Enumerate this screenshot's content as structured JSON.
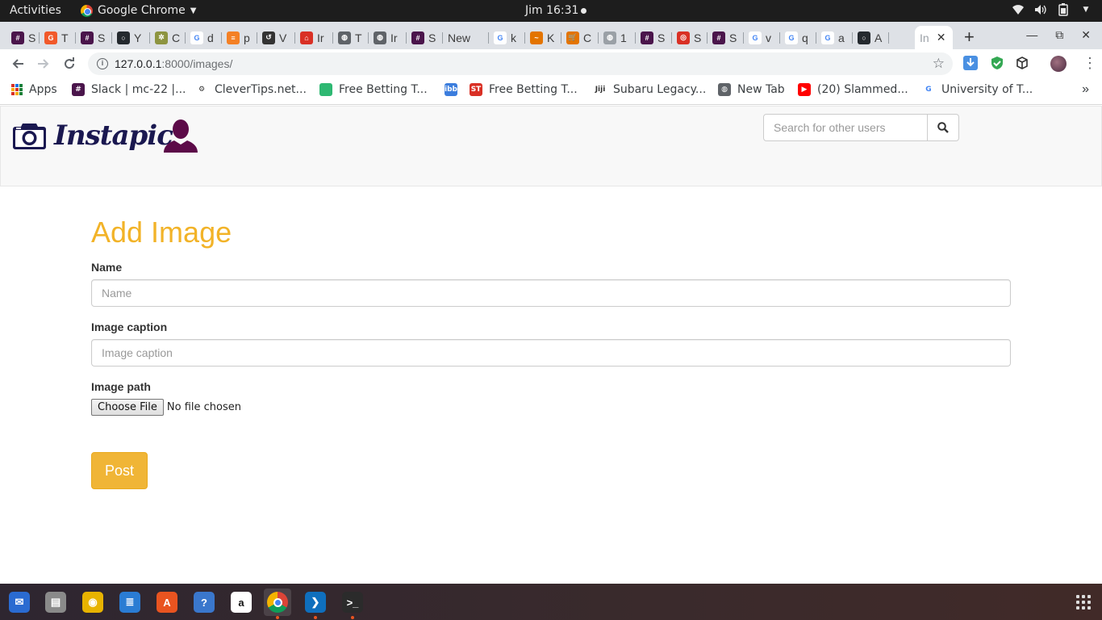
{
  "system": {
    "activities": "Activities",
    "app_name": "Google Chrome",
    "clock": "Jim 16:31"
  },
  "tabs": [
    {
      "label": "S",
      "color": "#4a154b",
      "glyph": "#"
    },
    {
      "label": "T",
      "color": "#f1592a",
      "glyph": "G"
    },
    {
      "label": "S",
      "color": "#4a154b",
      "glyph": "#"
    },
    {
      "label": "Y",
      "color": "#24292e",
      "glyph": "○"
    },
    {
      "label": "C",
      "color": "#8d9440",
      "glyph": "✲"
    },
    {
      "label": "d",
      "color": "#4285f4",
      "glyph": "G"
    },
    {
      "label": "p",
      "color": "#f48024",
      "glyph": "≡"
    },
    {
      "label": "V",
      "color": "#333333",
      "glyph": "↺"
    },
    {
      "label": "Ir",
      "color": "#d93025",
      "glyph": "⌂"
    },
    {
      "label": "T",
      "color": "#5f6368",
      "glyph": "◍"
    },
    {
      "label": "Ir",
      "color": "#5f6368",
      "glyph": "◍"
    },
    {
      "label": "S",
      "color": "#4a154b",
      "glyph": "#"
    },
    {
      "label": "New",
      "color": "#ffffff",
      "glyph": ""
    },
    {
      "label": "k",
      "color": "#4285f4",
      "glyph": "G"
    },
    {
      "label": "K",
      "color": "#e37400",
      "glyph": "~"
    },
    {
      "label": "C",
      "color": "#e37400",
      "glyph": "🛒"
    },
    {
      "label": "1",
      "color": "#9aa0a6",
      "glyph": "◍"
    },
    {
      "label": "S",
      "color": "#4a154b",
      "glyph": "#"
    },
    {
      "label": "S",
      "color": "#d93025",
      "glyph": "◎"
    },
    {
      "label": "S",
      "color": "#4a154b",
      "glyph": "#"
    },
    {
      "label": "v",
      "color": "#4285f4",
      "glyph": "G"
    },
    {
      "label": "q",
      "color": "#4285f4",
      "glyph": "G"
    },
    {
      "label": "a",
      "color": "#4285f4",
      "glyph": "G"
    },
    {
      "label": "A",
      "color": "#24292e",
      "glyph": "○"
    }
  ],
  "active_tab": {
    "label": "In",
    "close": "✕"
  },
  "new_tab": "+",
  "window_controls": {
    "minimize": "—",
    "restore": "⧉",
    "close": "✕"
  },
  "address_bar": {
    "host": "127.0.0.1",
    "path": ":8000/images/"
  },
  "bookmarks": [
    {
      "label": "Apps",
      "icon": "apps-grid-icon"
    },
    {
      "label": "Slack | mc-22 |...",
      "icon": "slack-icon",
      "color": "#4a154b",
      "glyph": "#"
    },
    {
      "label": "CleverTips.net...",
      "icon": "clevertips-icon",
      "color": "#ffffff",
      "glyph": "⚙"
    },
    {
      "label": "Free Betting T...",
      "icon": "bet-icon",
      "color": "#2eb872",
      "glyph": ""
    },
    {
      "label": "",
      "icon": "ibb-icon",
      "color": "#3b7ddd",
      "glyph": "ibb"
    },
    {
      "label": "Free Betting T...",
      "icon": "st-icon",
      "color": "#d93025",
      "glyph": "ST"
    },
    {
      "label": "Subaru Legacy...",
      "icon": "jiji-icon",
      "color": "#ffffff",
      "glyph": "Jiji"
    },
    {
      "label": "New Tab",
      "icon": "globe-icon",
      "color": "#5f6368",
      "glyph": "◍"
    },
    {
      "label": "(20) Slammed...",
      "icon": "youtube-icon",
      "color": "#ff0000",
      "glyph": "▶"
    },
    {
      "label": "University of T...",
      "icon": "google-icon",
      "color": "#ffffff",
      "glyph": "G"
    }
  ],
  "bookmarks_more": "»",
  "site": {
    "brand": "Instapic",
    "search_placeholder": "Search for other users"
  },
  "form": {
    "title": "Add Image",
    "name_label": "Name",
    "name_placeholder": "Name",
    "caption_label": "Image caption",
    "caption_placeholder": "Image caption",
    "path_label": "Image path",
    "file_button": "Choose File",
    "file_status": "No file chosen",
    "submit": "Post"
  },
  "colors": {
    "accent": "#f2b328",
    "brand": "#1a1850",
    "user_icon": "#5c0a48"
  },
  "dock": [
    {
      "name": "thunderbird-icon",
      "color": "#2a6bd1",
      "glyph": "✉"
    },
    {
      "name": "files-icon",
      "color": "#8a8a8a",
      "glyph": "▤"
    },
    {
      "name": "rhythmbox-icon",
      "color": "#e8b300",
      "glyph": "◉"
    },
    {
      "name": "writer-icon",
      "color": "#2a7cd3",
      "glyph": "≣"
    },
    {
      "name": "software-center-icon",
      "color": "#e95420",
      "glyph": "A"
    },
    {
      "name": "help-icon",
      "color": "#3a77cc",
      "glyph": "?"
    },
    {
      "name": "amazon-icon",
      "color": "#333333",
      "glyph": "a"
    },
    {
      "name": "chrome-icon",
      "color": "#ffffff",
      "glyph": ""
    },
    {
      "name": "vscode-icon",
      "color": "#0f6fbd",
      "glyph": "❯"
    },
    {
      "name": "terminal-icon",
      "color": "#2b2b2b",
      "glyph": ">_"
    }
  ]
}
